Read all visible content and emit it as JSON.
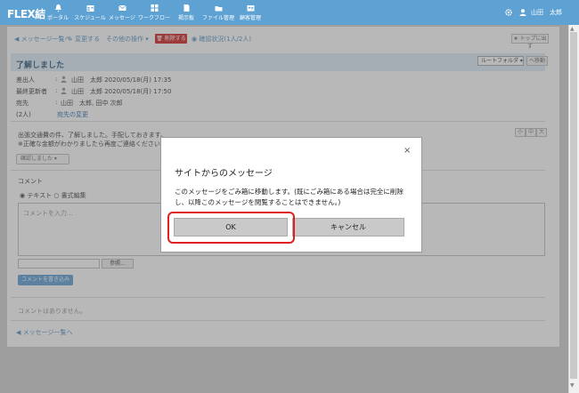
{
  "nav": {
    "brand": "FLEX結",
    "items": [
      {
        "label": "ポータル",
        "icon": "bell-icon"
      },
      {
        "label": "スケジュール",
        "icon": "calendar-icon"
      },
      {
        "label": "メッセージ",
        "icon": "envelope-icon"
      },
      {
        "label": "ワークフロー",
        "icon": "workflow-icon"
      },
      {
        "label": "掲示板",
        "icon": "board-icon"
      },
      {
        "label": "ファイル管理",
        "icon": "folder-icon"
      },
      {
        "label": "顧客管理",
        "icon": "customer-icon"
      }
    ],
    "user": "山田　太郎"
  },
  "toolbar": {
    "back": "◀ メッセージ一覧へ",
    "edit": "✎ 変更する",
    "other_ops": "その他の操作 ▾",
    "delete": "🗑 削除する",
    "confirm_status": "◉ 確認状況(1人/2人)",
    "to_top": "★ トップに出す"
  },
  "message": {
    "title": "了解しました",
    "folder": "ルートフォルダ ▾",
    "move": "へ移動",
    "sender_label": "差出人",
    "sender": "山田　太郎 2020/05/18(月) 17:35",
    "updater_label": "最終更新者",
    "updater": "山田　太郎 2020/05/18(月) 17:50",
    "dest_label": "宛先",
    "dest": "山田　太郎, 田中 次郎",
    "count": "(2人)",
    "dest_change": "宛先の変更",
    "colon": ":",
    "body_line1": "出張交通費の件、了解しました。手配しておきます。",
    "body_line2": "※正確な金額がわかりましたら再度ご連絡ください。",
    "font_small": "小",
    "font_mid": "中",
    "font_large": "大",
    "confirm_btn": "確認しました ▾"
  },
  "comment": {
    "heading": "コメント",
    "mode": "◉ テキスト ○ 書式編集",
    "placeholder": "コメントを入力...",
    "browse": "参照...",
    "post": "コメントを書き込み",
    "none": "コメントはありません。",
    "back_bottom": "◀ メッセージ一覧へ"
  },
  "dialog": {
    "title": "サイトからのメッセージ",
    "message": "このメッセージをごみ箱に移動します。(既にごみ箱にある場合は完全に削除し、以降このメッセージを閲覧することはできません。)",
    "ok": "OK",
    "cancel": "キャンセル",
    "close": "×"
  },
  "colors": {
    "header": "#5ea2d4",
    "delete": "#d9534f",
    "highlight": "#e02020"
  }
}
